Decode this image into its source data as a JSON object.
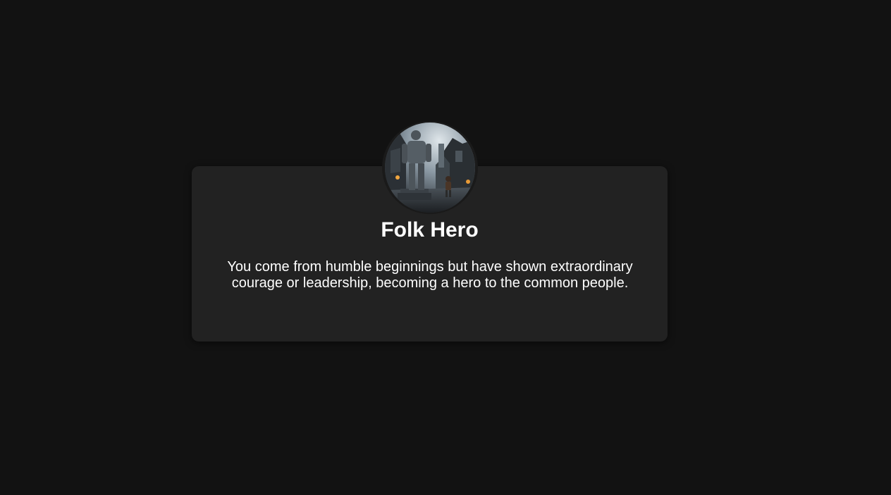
{
  "card": {
    "title": "Folk Hero",
    "description": "You come from humble beginnings but have shown extraordinary courage or leadership, becoming a hero to the common people.",
    "avatar_icon": "hero-statue-portrait"
  },
  "colors": {
    "background": "#121212",
    "card": "#222222",
    "text": "#ffffff"
  }
}
